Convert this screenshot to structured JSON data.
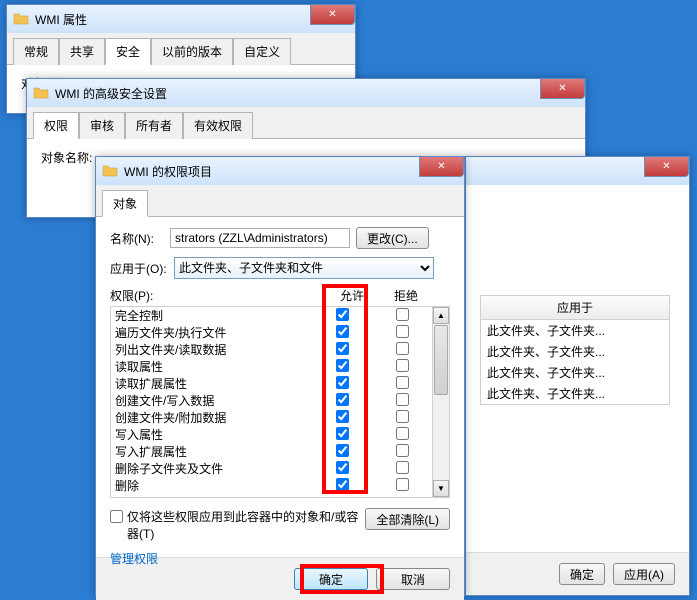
{
  "win_properties": {
    "title": "WMI 属性",
    "tabs": [
      "常规",
      "共享",
      "安全",
      "以前的版本",
      "自定义"
    ],
    "active_tab": 2,
    "object_label": "对象名称:"
  },
  "win_advanced": {
    "title": "WMI 的高级安全设置",
    "tabs": [
      "权限",
      "审核",
      "所有者",
      "有效权限"
    ],
    "active_tab": 0,
    "object_label": "对象名称:"
  },
  "win_bgright": {
    "apply_header": "应用于",
    "apply_items": [
      "此文件夹、子文件夹...",
      "此文件夹、子文件夹...",
      "此文件夹、子文件夹...",
      "此文件夹、子文件夹..."
    ],
    "btn_apply": "应用(A)",
    "btn_ok": "确定"
  },
  "win_perm": {
    "title": "WMI 的权限项目",
    "tab": "对象",
    "name_label": "名称(N):",
    "name_value": "strators (ZZL\\Administrators)",
    "change_btn": "更改(C)...",
    "apply_label": "应用于(O):",
    "apply_value": "此文件夹、子文件夹和文件",
    "perm_label": "权限(P):",
    "col_allow": "允许",
    "col_deny": "拒绝",
    "perms": [
      {
        "name": "完全控制",
        "allow": true,
        "deny": false
      },
      {
        "name": "遍历文件夹/执行文件",
        "allow": true,
        "deny": false
      },
      {
        "name": "列出文件夹/读取数据",
        "allow": true,
        "deny": false
      },
      {
        "name": "读取属性",
        "allow": true,
        "deny": false
      },
      {
        "name": "读取扩展属性",
        "allow": true,
        "deny": false
      },
      {
        "name": "创建文件/写入数据",
        "allow": true,
        "deny": false
      },
      {
        "name": "创建文件夹/附加数据",
        "allow": true,
        "deny": false
      },
      {
        "name": "写入属性",
        "allow": true,
        "deny": false
      },
      {
        "name": "写入扩展属性",
        "allow": true,
        "deny": false
      },
      {
        "name": "删除子文件夹及文件",
        "allow": true,
        "deny": false
      },
      {
        "name": "删除",
        "allow": true,
        "deny": false
      }
    ],
    "only_apply_label": "仅将这些权限应用到此容器中的对象和/或容器(T)",
    "only_apply_checked": false,
    "clear_all_btn": "全部清除(L)",
    "manage_link": "管理权限",
    "ok_btn": "确定",
    "cancel_btn": "取消"
  }
}
